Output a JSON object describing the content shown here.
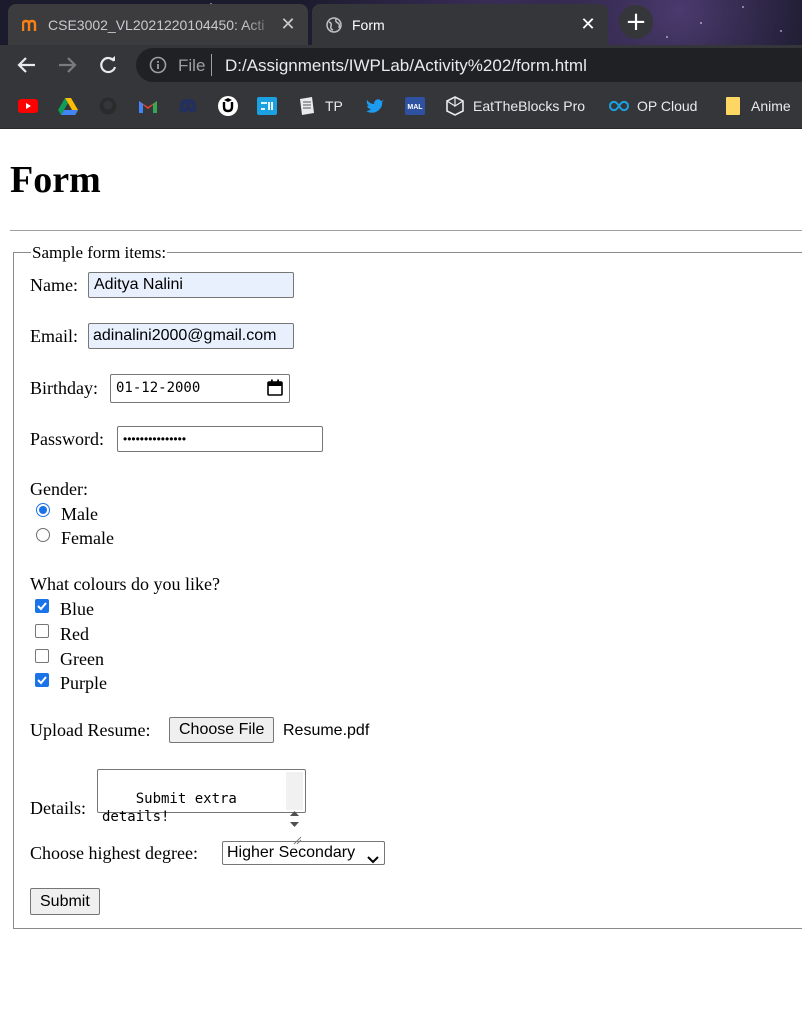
{
  "browser": {
    "tabs": [
      {
        "title": "CSE3002_VL2021220104450: Acti",
        "active": false
      },
      {
        "title": "Form",
        "active": true
      }
    ],
    "url_scheme": "File",
    "url": "D:/Assignments/IWPLab/Activity%202/form.html",
    "bookmarks": [
      {
        "label": "",
        "icon": "youtube-icon"
      },
      {
        "label": "",
        "icon": "google-drive-icon"
      },
      {
        "label": "",
        "icon": "github-icon"
      },
      {
        "label": "",
        "icon": "gmail-icon"
      },
      {
        "label": "",
        "icon": "discord-icon"
      },
      {
        "label": "",
        "icon": "udemy-icon"
      },
      {
        "label": "",
        "icon": "freecodecamp-icon"
      },
      {
        "label": "TP",
        "icon": "tp-icon"
      },
      {
        "label": "",
        "icon": "twitter-icon"
      },
      {
        "label": "",
        "icon": "myanimelist-icon"
      },
      {
        "label": "EatTheBlocks Pro",
        "icon": "eattheblocks-icon"
      },
      {
        "label": "OP Cloud",
        "icon": "op-cloud-icon"
      },
      {
        "label": "Anime",
        "icon": "folder-icon"
      }
    ],
    "colors": {
      "accent": "#1a73e8",
      "chrome_bg": "#35363a"
    }
  },
  "page": {
    "heading": "Form",
    "legend": "Sample form items:",
    "name": {
      "label": "Name:",
      "value": "Aditya Nalini"
    },
    "email": {
      "label": "Email:",
      "value": "adinalini2000@gmail.com"
    },
    "birthday": {
      "label": "Birthday:",
      "value": "01-12-2000"
    },
    "password": {
      "label": "Password:",
      "value": "•••••••••••••••"
    },
    "gender": {
      "label": "Gender:",
      "options": [
        "Male",
        "Female"
      ],
      "selected": "Male"
    },
    "colours": {
      "label": "What colours do you like?",
      "options": [
        {
          "label": "Blue",
          "checked": true
        },
        {
          "label": "Red",
          "checked": false
        },
        {
          "label": "Green",
          "checked": false
        },
        {
          "label": "Purple",
          "checked": true
        }
      ]
    },
    "resume": {
      "label": "Upload Resume:",
      "button": "Choose File",
      "filename": "Resume.pdf"
    },
    "details": {
      "label": "Details:",
      "value": "Submit extra\ndetails!"
    },
    "degree": {
      "label": "Choose highest degree:",
      "selected": "Higher Secondary"
    },
    "submit": "Submit"
  }
}
